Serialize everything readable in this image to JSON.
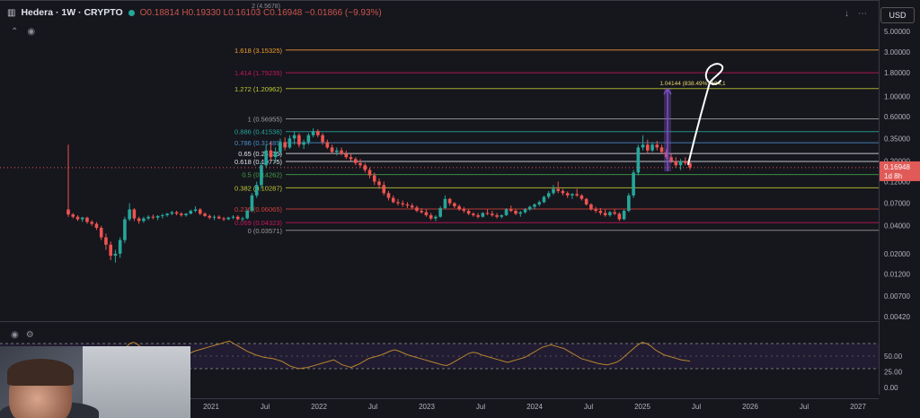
{
  "header": {
    "symbol": "Hedera · 1W · CRYPTO",
    "ohlc_values": "O0.18814 H0.19330 L0.16103 C0.16948 −0.01866 (−9.93%)",
    "top_partial_label": "2 (4.5678)"
  },
  "currency_button": "USD",
  "icons": [
    "collapse-icon",
    "eye-icon",
    "settings-icon",
    "chevron-down-icon",
    "more-icon"
  ],
  "colors": {
    "background": "#16161d",
    "up": "#26a69a",
    "down": "#ef5350",
    "rsi_line": "#b8862f",
    "current_price_label": "#e05a57",
    "measure": "#7b4fc7"
  },
  "chart_data": {
    "type": "candlestick",
    "title": "Hedera · 1W · CRYPTO",
    "scale": "log",
    "ylim": [
      0.004,
      8
    ],
    "price_axis_ticks": [
      "5.00000",
      "3.00000",
      "1.80000",
      "1.00000",
      "0.60000",
      "0.35000",
      "0.20000",
      "0.12000",
      "0.07000",
      "0.04000",
      "0.02000",
      "0.01200",
      "0.00700",
      "0.00420"
    ],
    "x_axis_ticks": [
      "2021",
      "Jul",
      "2022",
      "Jul",
      "2023",
      "Jul",
      "2024",
      "Jul",
      "2025",
      "Jul",
      "2026",
      "Jul",
      "2027"
    ],
    "fib_levels": [
      {
        "label": "1.618 (3.15325)",
        "value": 3.15325,
        "color": "#f0a030"
      },
      {
        "label": "1.414 (1.79235)",
        "value": 1.79235,
        "color": "#c2185b"
      },
      {
        "label": "1.272 (1.20962)",
        "value": 1.20962,
        "color": "#c0ca33"
      },
      {
        "label": "1 (0.56955)",
        "value": 0.56955,
        "color": "#9e9e9e"
      },
      {
        "label": "0.886 (0.41536)",
        "value": 0.41536,
        "color": "#26a69a"
      },
      {
        "label": "0.786 (0.31489)",
        "value": 0.31489,
        "color": "#4a90c8"
      },
      {
        "label": "0.65 (0.24135)",
        "value": 0.24135,
        "color": "#e0e3eb"
      },
      {
        "label": "0.618 (0.19775)",
        "value": 0.19775,
        "color": "#e0e3eb"
      },
      {
        "label": "0.5 (0.14262)",
        "value": 0.14262,
        "color": "#43a047"
      },
      {
        "label": "0.382 (0.10287)",
        "value": 0.10287,
        "color": "#c0ca33"
      },
      {
        "label": "0.236 (0.06065)",
        "value": 0.06065,
        "color": "#d0403a"
      },
      {
        "label": "0.069 (0.04323)",
        "value": 0.04323,
        "color": "#c2185b"
      },
      {
        "label": "0 (0.03571)",
        "value": 0.03571,
        "color": "#9e9e9e"
      }
    ],
    "current_price": {
      "value": 0.16948,
      "label": "0.16948",
      "countdown": "1d 8h"
    },
    "measure_label": "1.04144 (838.49%) 104,1",
    "rsi": {
      "ylim": [
        0,
        100
      ],
      "ticks": [
        "50.00",
        "25.00",
        "0.00"
      ],
      "bands": [
        70,
        30
      ],
      "values": [
        66,
        60,
        58,
        55,
        62,
        70,
        72,
        68,
        60,
        55,
        52,
        50,
        48,
        55,
        60,
        58,
        56,
        54,
        52,
        55,
        58,
        60,
        62,
        64,
        66,
        68,
        70,
        72,
        74,
        70,
        66,
        62,
        58,
        55,
        52,
        50,
        48,
        47,
        46,
        44,
        42,
        38,
        34,
        32,
        30,
        31,
        32,
        34,
        36,
        38,
        40,
        42,
        44,
        40,
        36,
        34,
        32,
        35,
        38,
        42,
        46,
        48,
        50,
        52,
        55,
        58,
        60,
        58,
        55,
        52,
        50,
        48,
        46,
        44,
        42,
        40,
        38,
        36,
        35,
        38,
        42,
        46,
        50,
        54,
        56,
        55,
        52,
        50,
        48,
        46,
        44,
        42,
        40,
        42,
        44,
        46,
        48,
        52,
        56,
        60,
        64,
        66,
        68,
        66,
        64,
        62,
        58,
        54,
        50,
        46,
        44,
        42,
        40,
        38,
        37,
        36,
        38,
        40,
        44,
        50,
        56,
        62,
        68,
        72,
        70,
        66,
        60,
        56,
        52,
        50,
        48,
        46,
        44,
        43,
        42
      ]
    },
    "candles": [
      [
        0.06,
        0.3,
        0.05,
        0.053
      ],
      [
        0.053,
        0.055,
        0.048,
        0.05
      ],
      [
        0.05,
        0.052,
        0.045,
        0.047
      ],
      [
        0.047,
        0.05,
        0.044,
        0.049
      ],
      [
        0.049,
        0.05,
        0.042,
        0.044
      ],
      [
        0.044,
        0.046,
        0.04,
        0.042
      ],
      [
        0.042,
        0.044,
        0.036,
        0.038
      ],
      [
        0.038,
        0.04,
        0.028,
        0.03
      ],
      [
        0.03,
        0.033,
        0.022,
        0.025
      ],
      [
        0.025,
        0.027,
        0.017,
        0.019
      ],
      [
        0.019,
        0.022,
        0.016,
        0.02
      ],
      [
        0.02,
        0.03,
        0.018,
        0.028
      ],
      [
        0.028,
        0.05,
        0.026,
        0.047
      ],
      [
        0.047,
        0.07,
        0.045,
        0.06
      ],
      [
        0.06,
        0.062,
        0.045,
        0.048
      ],
      [
        0.048,
        0.05,
        0.042,
        0.045
      ],
      [
        0.045,
        0.05,
        0.043,
        0.048
      ],
      [
        0.048,
        0.052,
        0.046,
        0.05
      ],
      [
        0.05,
        0.053,
        0.047,
        0.049
      ],
      [
        0.049,
        0.052,
        0.046,
        0.051
      ],
      [
        0.051,
        0.054,
        0.048,
        0.052
      ],
      [
        0.052,
        0.055,
        0.05,
        0.054
      ],
      [
        0.054,
        0.058,
        0.052,
        0.056
      ],
      [
        0.056,
        0.058,
        0.052,
        0.054
      ],
      [
        0.054,
        0.056,
        0.05,
        0.052
      ],
      [
        0.052,
        0.055,
        0.05,
        0.054
      ],
      [
        0.054,
        0.06,
        0.053,
        0.058
      ],
      [
        0.058,
        0.065,
        0.056,
        0.06
      ],
      [
        0.06,
        0.062,
        0.052,
        0.054
      ],
      [
        0.054,
        0.056,
        0.05,
        0.051
      ],
      [
        0.051,
        0.053,
        0.047,
        0.049
      ],
      [
        0.049,
        0.052,
        0.046,
        0.05
      ],
      [
        0.05,
        0.052,
        0.047,
        0.048
      ],
      [
        0.048,
        0.05,
        0.045,
        0.047
      ],
      [
        0.047,
        0.05,
        0.046,
        0.049
      ],
      [
        0.049,
        0.052,
        0.047,
        0.05
      ],
      [
        0.05,
        0.052,
        0.046,
        0.047
      ],
      [
        0.047,
        0.05,
        0.045,
        0.048
      ],
      [
        0.048,
        0.06,
        0.047,
        0.058
      ],
      [
        0.058,
        0.09,
        0.056,
        0.085
      ],
      [
        0.085,
        0.12,
        0.08,
        0.11
      ],
      [
        0.11,
        0.2,
        0.1,
        0.18
      ],
      [
        0.18,
        0.3,
        0.17,
        0.26
      ],
      [
        0.26,
        0.32,
        0.2,
        0.22
      ],
      [
        0.22,
        0.28,
        0.19,
        0.25
      ],
      [
        0.25,
        0.35,
        0.23,
        0.32
      ],
      [
        0.32,
        0.36,
        0.26,
        0.28
      ],
      [
        0.28,
        0.38,
        0.27,
        0.35
      ],
      [
        0.35,
        0.42,
        0.3,
        0.38
      ],
      [
        0.38,
        0.4,
        0.28,
        0.3
      ],
      [
        0.3,
        0.34,
        0.27,
        0.32
      ],
      [
        0.32,
        0.4,
        0.3,
        0.38
      ],
      [
        0.38,
        0.45,
        0.36,
        0.42
      ],
      [
        0.42,
        0.44,
        0.36,
        0.38
      ],
      [
        0.38,
        0.4,
        0.3,
        0.32
      ],
      [
        0.32,
        0.34,
        0.27,
        0.28
      ],
      [
        0.28,
        0.3,
        0.24,
        0.25
      ],
      [
        0.25,
        0.28,
        0.23,
        0.26
      ],
      [
        0.26,
        0.28,
        0.23,
        0.24
      ],
      [
        0.24,
        0.26,
        0.21,
        0.22
      ],
      [
        0.22,
        0.24,
        0.2,
        0.21
      ],
      [
        0.21,
        0.22,
        0.18,
        0.19
      ],
      [
        0.19,
        0.21,
        0.17,
        0.18
      ],
      [
        0.18,
        0.19,
        0.15,
        0.16
      ],
      [
        0.16,
        0.17,
        0.13,
        0.14
      ],
      [
        0.14,
        0.15,
        0.11,
        0.12
      ],
      [
        0.12,
        0.13,
        0.1,
        0.11
      ],
      [
        0.11,
        0.12,
        0.085,
        0.09
      ],
      [
        0.09,
        0.095,
        0.075,
        0.08
      ],
      [
        0.08,
        0.085,
        0.07,
        0.072
      ],
      [
        0.072,
        0.078,
        0.066,
        0.07
      ],
      [
        0.07,
        0.075,
        0.064,
        0.068
      ],
      [
        0.068,
        0.072,
        0.062,
        0.066
      ],
      [
        0.066,
        0.07,
        0.06,
        0.063
      ],
      [
        0.063,
        0.066,
        0.056,
        0.058
      ],
      [
        0.058,
        0.062,
        0.054,
        0.056
      ],
      [
        0.056,
        0.06,
        0.05,
        0.052
      ],
      [
        0.052,
        0.055,
        0.046,
        0.048
      ],
      [
        0.048,
        0.052,
        0.045,
        0.05
      ],
      [
        0.05,
        0.065,
        0.049,
        0.062
      ],
      [
        0.062,
        0.085,
        0.06,
        0.078
      ],
      [
        0.078,
        0.08,
        0.066,
        0.07
      ],
      [
        0.07,
        0.072,
        0.062,
        0.065
      ],
      [
        0.065,
        0.068,
        0.058,
        0.06
      ],
      [
        0.06,
        0.064,
        0.055,
        0.058
      ],
      [
        0.058,
        0.06,
        0.052,
        0.054
      ],
      [
        0.054,
        0.056,
        0.05,
        0.052
      ],
      [
        0.052,
        0.055,
        0.048,
        0.05
      ],
      [
        0.05,
        0.056,
        0.049,
        0.055
      ],
      [
        0.055,
        0.06,
        0.052,
        0.054
      ],
      [
        0.054,
        0.058,
        0.05,
        0.052
      ],
      [
        0.052,
        0.055,
        0.048,
        0.05
      ],
      [
        0.05,
        0.053,
        0.048,
        0.052
      ],
      [
        0.052,
        0.062,
        0.051,
        0.06
      ],
      [
        0.06,
        0.066,
        0.056,
        0.058
      ],
      [
        0.058,
        0.06,
        0.052,
        0.054
      ],
      [
        0.054,
        0.058,
        0.05,
        0.056
      ],
      [
        0.056,
        0.062,
        0.054,
        0.06
      ],
      [
        0.06,
        0.066,
        0.058,
        0.064
      ],
      [
        0.064,
        0.07,
        0.06,
        0.068
      ],
      [
        0.068,
        0.075,
        0.065,
        0.072
      ],
      [
        0.072,
        0.085,
        0.07,
        0.082
      ],
      [
        0.082,
        0.095,
        0.078,
        0.09
      ],
      [
        0.09,
        0.11,
        0.086,
        0.1
      ],
      [
        0.1,
        0.12,
        0.09,
        0.095
      ],
      [
        0.095,
        0.1,
        0.085,
        0.09
      ],
      [
        0.09,
        0.094,
        0.08,
        0.085
      ],
      [
        0.085,
        0.09,
        0.078,
        0.088
      ],
      [
        0.088,
        0.1,
        0.082,
        0.085
      ],
      [
        0.085,
        0.088,
        0.075,
        0.078
      ],
      [
        0.078,
        0.08,
        0.066,
        0.068
      ],
      [
        0.068,
        0.07,
        0.058,
        0.06
      ],
      [
        0.06,
        0.064,
        0.055,
        0.058
      ],
      [
        0.058,
        0.062,
        0.052,
        0.055
      ],
      [
        0.055,
        0.06,
        0.05,
        0.052
      ],
      [
        0.052,
        0.058,
        0.05,
        0.056
      ],
      [
        0.056,
        0.06,
        0.052,
        0.054
      ],
      [
        0.054,
        0.056,
        0.045,
        0.047
      ],
      [
        0.047,
        0.06,
        0.046,
        0.058
      ],
      [
        0.058,
        0.09,
        0.056,
        0.085
      ],
      [
        0.085,
        0.16,
        0.08,
        0.15
      ],
      [
        0.15,
        0.3,
        0.14,
        0.28
      ],
      [
        0.28,
        0.38,
        0.26,
        0.3
      ],
      [
        0.3,
        0.34,
        0.24,
        0.26
      ],
      [
        0.26,
        0.32,
        0.25,
        0.3
      ],
      [
        0.3,
        0.33,
        0.26,
        0.28
      ],
      [
        0.28,
        0.3,
        0.24,
        0.25
      ],
      [
        0.25,
        0.27,
        0.21,
        0.22
      ],
      [
        0.22,
        0.24,
        0.19,
        0.2
      ],
      [
        0.2,
        0.22,
        0.17,
        0.18
      ],
      [
        0.18,
        0.21,
        0.16,
        0.2
      ],
      [
        0.2,
        0.22,
        0.18,
        0.19
      ],
      [
        0.19,
        0.2,
        0.16,
        0.17
      ]
    ]
  }
}
